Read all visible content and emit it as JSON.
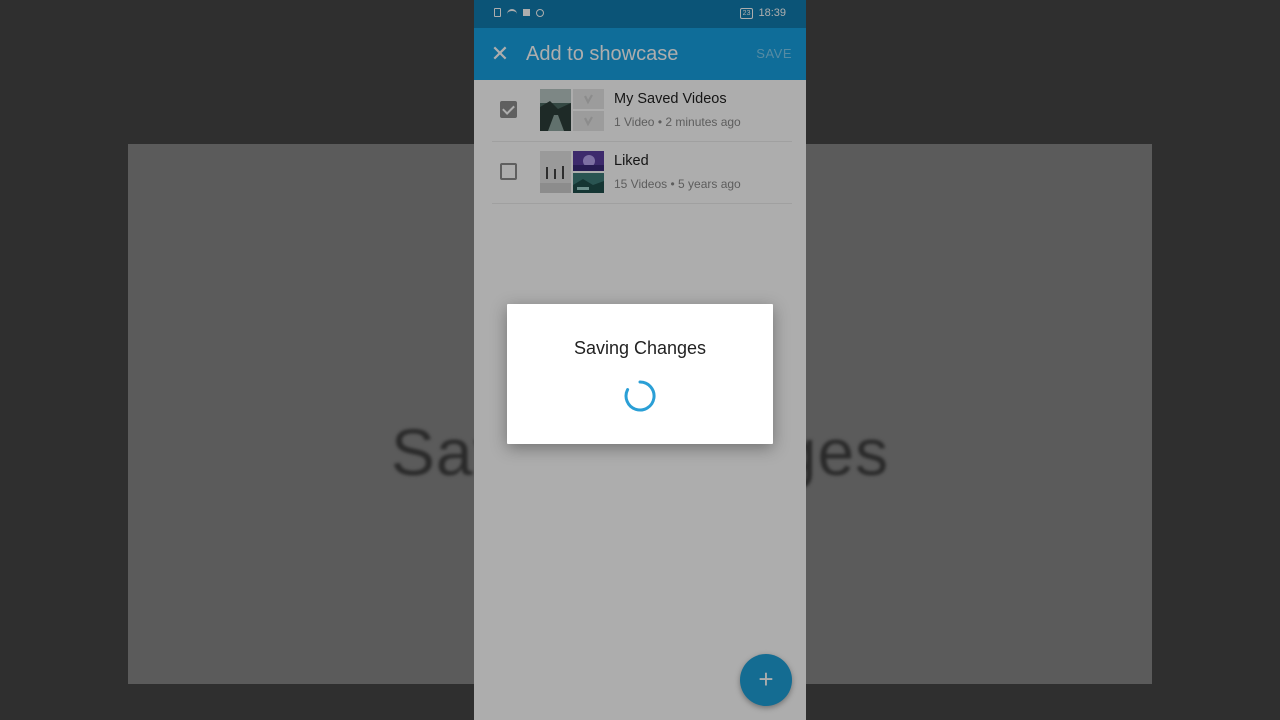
{
  "background": {
    "overlay_text": "Saving Changes"
  },
  "status_bar": {
    "icons": [
      "sim-icon",
      "wifi-icon",
      "square-icon",
      "record-icon"
    ],
    "battery": "23",
    "time": "18:39"
  },
  "app_bar": {
    "close_icon": "close-icon",
    "title": "Add to showcase",
    "save_label": "SAVE"
  },
  "albums": [
    {
      "title": "My Saved Videos",
      "meta": "1 Video • 2 minutes ago",
      "checked": true
    },
    {
      "title": "Liked",
      "meta": "15 Videos • 5 years ago",
      "checked": false
    }
  ],
  "fab": {
    "icon": "plus-icon",
    "label": "+"
  },
  "dialog": {
    "title": "Saving Changes",
    "spinner": "loading-spinner-icon"
  },
  "colors": {
    "status_bar": "#117db0",
    "app_bar": "#17a1e2",
    "fab": "#1e9fd8",
    "spinner": "#2a9fd6"
  }
}
